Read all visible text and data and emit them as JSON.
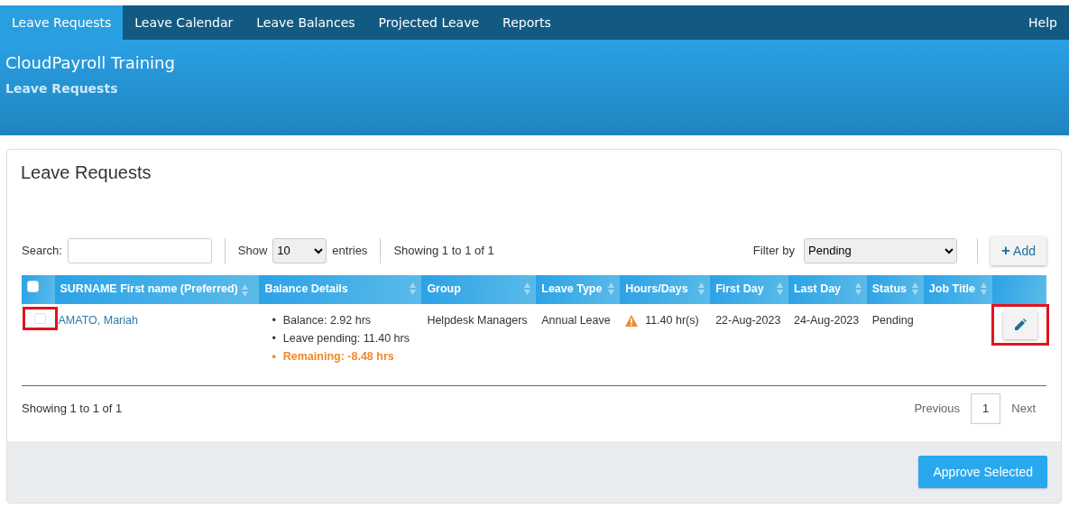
{
  "nav": {
    "tabs": [
      {
        "label": "Leave Requests",
        "selected": true
      },
      {
        "label": "Leave Calendar",
        "selected": false
      },
      {
        "label": "Leave Balances",
        "selected": false
      },
      {
        "label": "Projected Leave",
        "selected": false
      },
      {
        "label": "Reports",
        "selected": false
      }
    ],
    "help": "Help"
  },
  "header": {
    "company": "CloudPayroll Training",
    "page": "Leave Requests"
  },
  "panel": {
    "title": "Leave Requests",
    "search": {
      "label": "Search:"
    },
    "length": {
      "prefix": "Show",
      "value": "10",
      "suffix": "entries"
    },
    "info_top": "Showing 1 to 1 of 1",
    "filter": {
      "label": "Filter by",
      "value": "Pending"
    },
    "add_button": {
      "icon": "+",
      "label": "Add"
    },
    "table": {
      "select_all": {
        "checked": false
      },
      "columns": [
        "SURNAME First name (Preferred)",
        "Balance Details",
        "Group",
        "Leave Type",
        "Hours/Days",
        "First Day",
        "Last Day",
        "Status",
        "Job Title"
      ],
      "rows": [
        {
          "checked": false,
          "highlighted": true,
          "name": "AMATO, Mariah",
          "balance": [
            {
              "marker": "•",
              "text": "Balance: 2.92 hrs",
              "kind": "normal"
            },
            {
              "marker": "•",
              "text": "Leave pending: 11.40 hrs",
              "kind": "normal"
            },
            {
              "marker": "•",
              "text": "Remaining: -8.48 hrs",
              "kind": "warning"
            }
          ],
          "group": "Helpdesk Managers",
          "leave_type": "Annual Leave",
          "hours_warning": true,
          "hours": "11.40 hr(s)",
          "first_day": "22-Aug-2023",
          "last_day": "24-Aug-2023",
          "status": "Pending",
          "edit_highlighted": true
        }
      ]
    },
    "info_bottom": "Showing 1 to 1 of 1",
    "pagination": {
      "previous": "Previous",
      "pages": [
        {
          "label": "1",
          "selected": true
        }
      ],
      "next": "Next"
    },
    "approve_button": "Approve Selected"
  }
}
